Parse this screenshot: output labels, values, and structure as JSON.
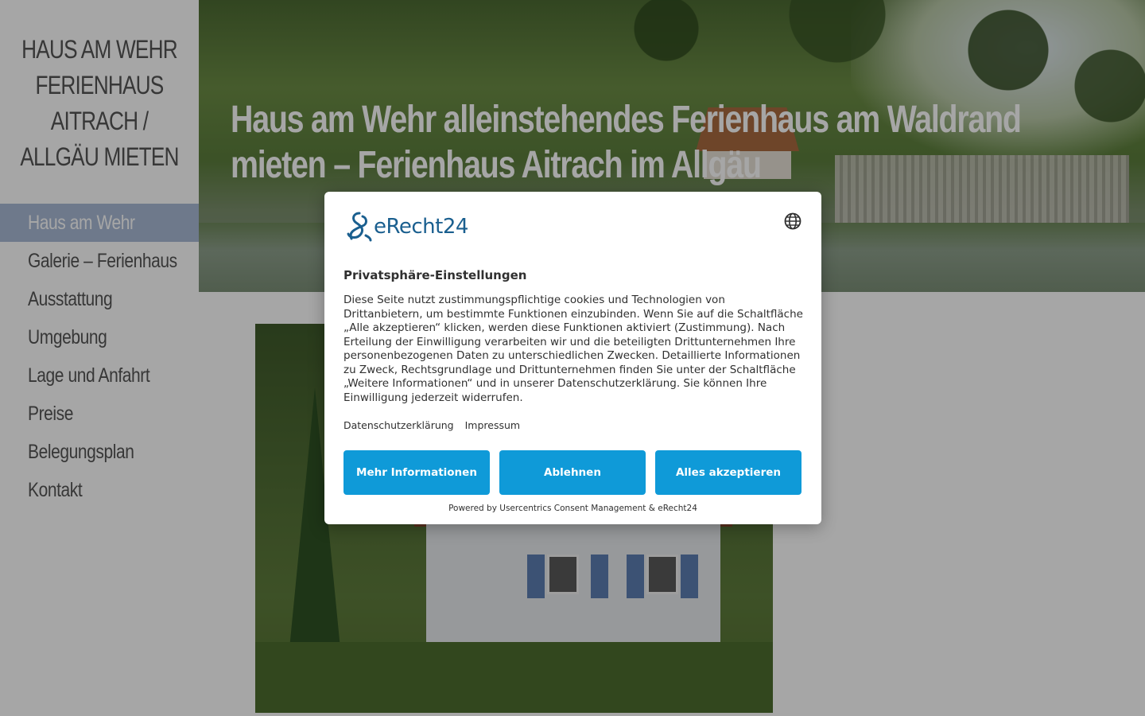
{
  "site": {
    "title_lines": [
      "HAUS AM WEHR",
      "FERIENHAUS",
      "AITRACH /",
      "ALLGÄU MIETEN"
    ]
  },
  "nav": {
    "items": [
      {
        "label": "Haus am Wehr",
        "active": true
      },
      {
        "label": "Galerie – Ferienhaus"
      },
      {
        "label": "Ausstattung"
      },
      {
        "label": "Umgebung"
      },
      {
        "label": "Lage und Anfahrt"
      },
      {
        "label": "Preise"
      },
      {
        "label": "Belegungsplan"
      },
      {
        "label": "Kontakt"
      }
    ]
  },
  "hero": {
    "title": "Haus am Wehr alleinstehendes Ferienhaus am Waldrand mieten – Ferienhaus Aitrach im Allgäu"
  },
  "consent": {
    "logo_text": "eRecht24",
    "language_icon": "globe-icon",
    "heading": "Privatsphäre-Einstellungen",
    "body": "Diese Seite nutzt zustimmungspflichtige cookies und Technologien von Drittanbietern, um bestimmte Funktionen einzubinden. Wenn Sie auf die Schaltfläche „Alle akzeptieren“ klicken, werden diese Funktionen aktiviert (Zustimmung). Nach Erteilung der Einwilligung verarbeiten wir und die beteiligten Drittunternehmen Ihre personenbezogenen Daten zu unterschiedlichen Zwecken. Detaillierte Informationen zu Zweck, Rechtsgrundlage und Drittunternehmen finden Sie unter der Schaltfläche „Weitere Informationen“ und in unserer Datenschutzerklärung. Sie können Ihre Einwilligung jederzeit widerrufen.",
    "links": {
      "privacy": "Datenschutzerklärung",
      "imprint": "Impressum"
    },
    "buttons": {
      "more": "Mehr Informationen",
      "deny": "Ablehnen",
      "accept": "Alles akzeptieren"
    },
    "powered_by": "Powered by Usercentrics Consent Management & eRecht24",
    "accent_color": "#0f9ad8"
  }
}
